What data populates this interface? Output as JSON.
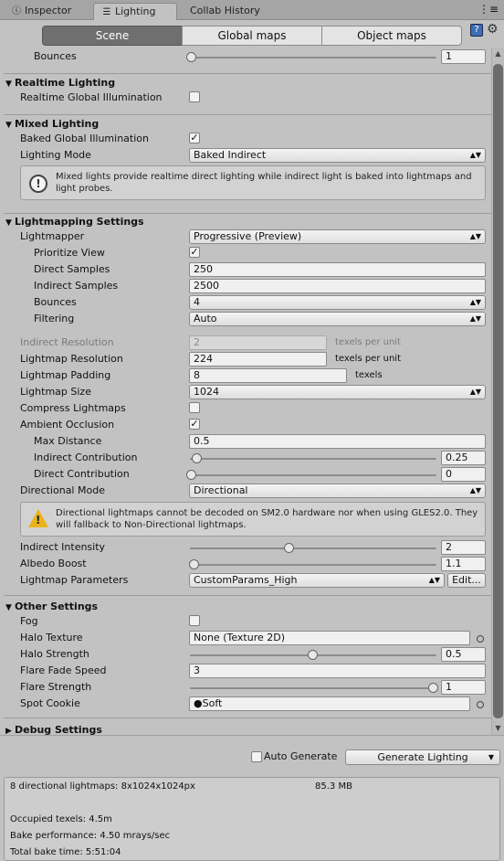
{
  "tabs": [
    {
      "label": "Inspector",
      "icon": "inspector-icon"
    },
    {
      "label": "Lighting",
      "icon": "lighting-icon"
    },
    {
      "label": "Collab History"
    }
  ],
  "toolbar": {
    "segments": [
      "Scene",
      "Global maps",
      "Object maps"
    ],
    "selected": "Scene"
  },
  "bounces_top": {
    "label": "Bounces",
    "value": "1"
  },
  "realtime": {
    "title": "Realtime Lighting",
    "gi_label": "Realtime Global Illumination",
    "gi_checked": false
  },
  "mixed": {
    "title": "Mixed Lighting",
    "baked_gi_label": "Baked Global Illumination",
    "baked_gi_checked": true,
    "mode_label": "Lighting Mode",
    "mode_value": "Baked Indirect",
    "help": "Mixed lights provide realtime direct lighting while indirect light is baked into lightmaps and light probes."
  },
  "lightmapping": {
    "title": "Lightmapping Settings",
    "lightmapper_label": "Lightmapper",
    "lightmapper_value": "Progressive (Preview)",
    "prioritize_label": "Prioritize View",
    "prioritize_checked": true,
    "direct_samples_label": "Direct Samples",
    "direct_samples_value": "250",
    "indirect_samples_label": "Indirect Samples",
    "indirect_samples_value": "2500",
    "bounces_label": "Bounces",
    "bounces_value": "4",
    "filtering_label": "Filtering",
    "filtering_value": "Auto",
    "indirect_res_label": "Indirect Resolution",
    "indirect_res_value": "2",
    "indirect_res_unit": "texels per unit",
    "lightmap_res_label": "Lightmap Resolution",
    "lightmap_res_value": "224",
    "lightmap_res_unit": "texels per unit",
    "padding_label": "Lightmap Padding",
    "padding_value": "8",
    "padding_unit": "texels",
    "size_label": "Lightmap Size",
    "size_value": "1024",
    "compress_label": "Compress Lightmaps",
    "compress_checked": false,
    "ao_label": "Ambient Occlusion",
    "ao_checked": true,
    "max_distance_label": "Max Distance",
    "max_distance_value": "0.5",
    "indirect_contrib_label": "Indirect Contribution",
    "indirect_contrib_value": "0.25",
    "direct_contrib_label": "Direct Contribution",
    "direct_contrib_value": "0",
    "directional_label": "Directional Mode",
    "directional_value": "Directional",
    "warning": "Directional lightmaps cannot be decoded on SM2.0 hardware nor when using GLES2.0. They will fallback to Non-Directional lightmaps.",
    "indirect_intensity_label": "Indirect Intensity",
    "indirect_intensity_value": "2",
    "albedo_label": "Albedo Boost",
    "albedo_value": "1.1",
    "params_label": "Lightmap Parameters",
    "params_value": "CustomParams_High",
    "edit_label": "Edit..."
  },
  "other": {
    "title": "Other Settings",
    "fog_label": "Fog",
    "fog_checked": false,
    "halo_tex_label": "Halo Texture",
    "halo_tex_value": "None (Texture 2D)",
    "halo_strength_label": "Halo Strength",
    "halo_strength_value": "0.5",
    "flare_fade_label": "Flare Fade Speed",
    "flare_fade_value": "3",
    "flare_strength_label": "Flare Strength",
    "flare_strength_value": "1",
    "spot_cookie_label": "Spot Cookie",
    "spot_cookie_value": "Soft"
  },
  "debug": {
    "title": "Debug Settings"
  },
  "bottom": {
    "auto_generate_label": "Auto Generate",
    "auto_generate_checked": false,
    "generate_label": "Generate Lighting",
    "stats_lightmaps": "8 directional lightmaps: 8x1024x1024px",
    "stats_size": "85.3 MB",
    "stats_occupied": "Occupied texels: 4.5m",
    "stats_perf": "Bake performance: 4.50 mrays/sec",
    "stats_time": "Total bake time: 5:51:04"
  }
}
